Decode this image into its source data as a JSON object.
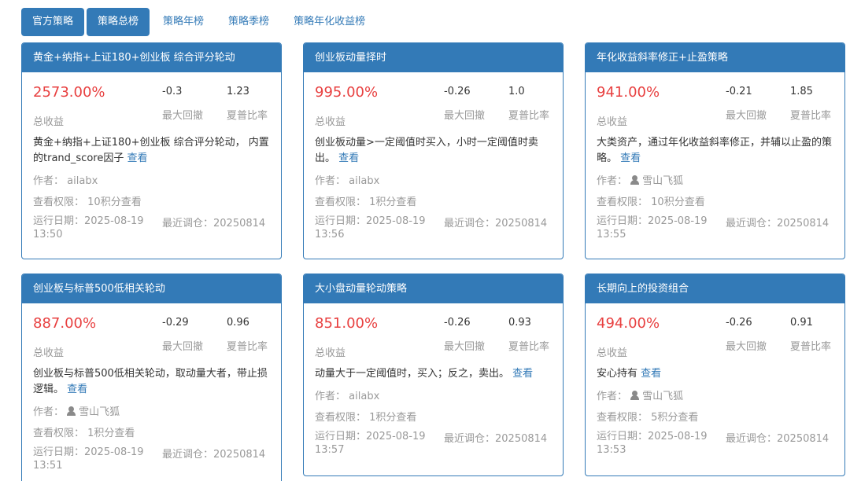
{
  "tabs": [
    "官方策略",
    "策略总榜",
    "策略年榜",
    "策略季榜",
    "策略年化收益榜"
  ],
  "labels": {
    "total_return": "总收益",
    "max_drawdown": "最大回撤",
    "sharpe": "夏普比率",
    "author": "作者：",
    "permission": "查看权限：",
    "run_date": "运行日期：",
    "rebalance": "最近调仓：",
    "view": "查看"
  },
  "cards": [
    {
      "title": "黄金+纳指+上证180+创业板 综合评分轮动",
      "ret": "2573.00%",
      "dd": "-0.3",
      "sharpe": "1.23",
      "desc": "黄金+纳指+上证180+创业板 综合评分轮动， 内置的trand_score因子",
      "author": "ailabx",
      "perm": "10积分查看",
      "run_date": "2025-08-19 13:50",
      "rebalance": "20250814"
    },
    {
      "title": "创业板动量择时",
      "ret": "995.00%",
      "dd": "-0.26",
      "sharpe": "1.0",
      "desc": "创业板动量>一定阈值时买入，小时一定阈值时卖出。",
      "author": "ailabx",
      "perm": "1积分查看",
      "run_date": "2025-08-19 13:56",
      "rebalance": "20250814"
    },
    {
      "title": "年化收益斜率修正+止盈策略",
      "ret": "941.00%",
      "dd": "-0.21",
      "sharpe": "1.85",
      "desc": "大类资产，通过年化收益斜率修正，并辅以止盈的策略。",
      "author": "雪山飞狐",
      "perm": "10积分查看",
      "run_date": "2025-08-19 13:55",
      "rebalance": "20250814"
    },
    {
      "title": "创业板与标普500低相关轮动",
      "ret": "887.00%",
      "dd": "-0.29",
      "sharpe": "0.96",
      "desc": "创业板与标普500低相关轮动，取动量大者，带止损逻辑。",
      "author": "雪山飞狐",
      "perm": "1积分查看",
      "run_date": "2025-08-19 13:51",
      "rebalance": "20250814"
    },
    {
      "title": "大小盘动量轮动策略",
      "ret": "851.00%",
      "dd": "-0.26",
      "sharpe": "0.93",
      "desc": "动量大于一定阈值时，买入；反之，卖出。",
      "author": "ailabx",
      "perm": "1积分查看",
      "run_date": "2025-08-19 13:57",
      "rebalance": "20250814"
    },
    {
      "title": "长期向上的投资组合",
      "ret": "494.00%",
      "dd": "-0.26",
      "sharpe": "0.91",
      "desc": "安心持有",
      "author": "雪山飞狐",
      "perm": "5积分查看",
      "run_date": "2025-08-19 13:53",
      "rebalance": "20250814"
    }
  ]
}
